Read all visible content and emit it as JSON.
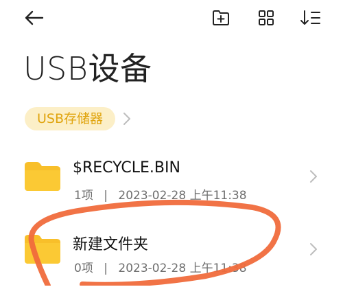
{
  "header": {
    "back_icon": "arrow-left-icon",
    "new_folder_icon": "add-folder-icon",
    "view_icon": "grid-view-icon",
    "sort_icon": "sort-icon"
  },
  "page": {
    "title": "USB设备"
  },
  "breadcrumb": {
    "label": "USB存储器"
  },
  "files": [
    {
      "name": "$RECYCLE.BIN",
      "count": "1项",
      "separator": "|",
      "date": "2023-02-28 上午11:38"
    },
    {
      "name": "新建文件夹",
      "count": "0项",
      "separator": "|",
      "date": "2023-02-28 上午11:38"
    }
  ],
  "colors": {
    "accent": "#e0a40e",
    "crumb_bg": "#fcefc7",
    "folder": "#f8bf2a",
    "annotation": "#f06c3c"
  }
}
